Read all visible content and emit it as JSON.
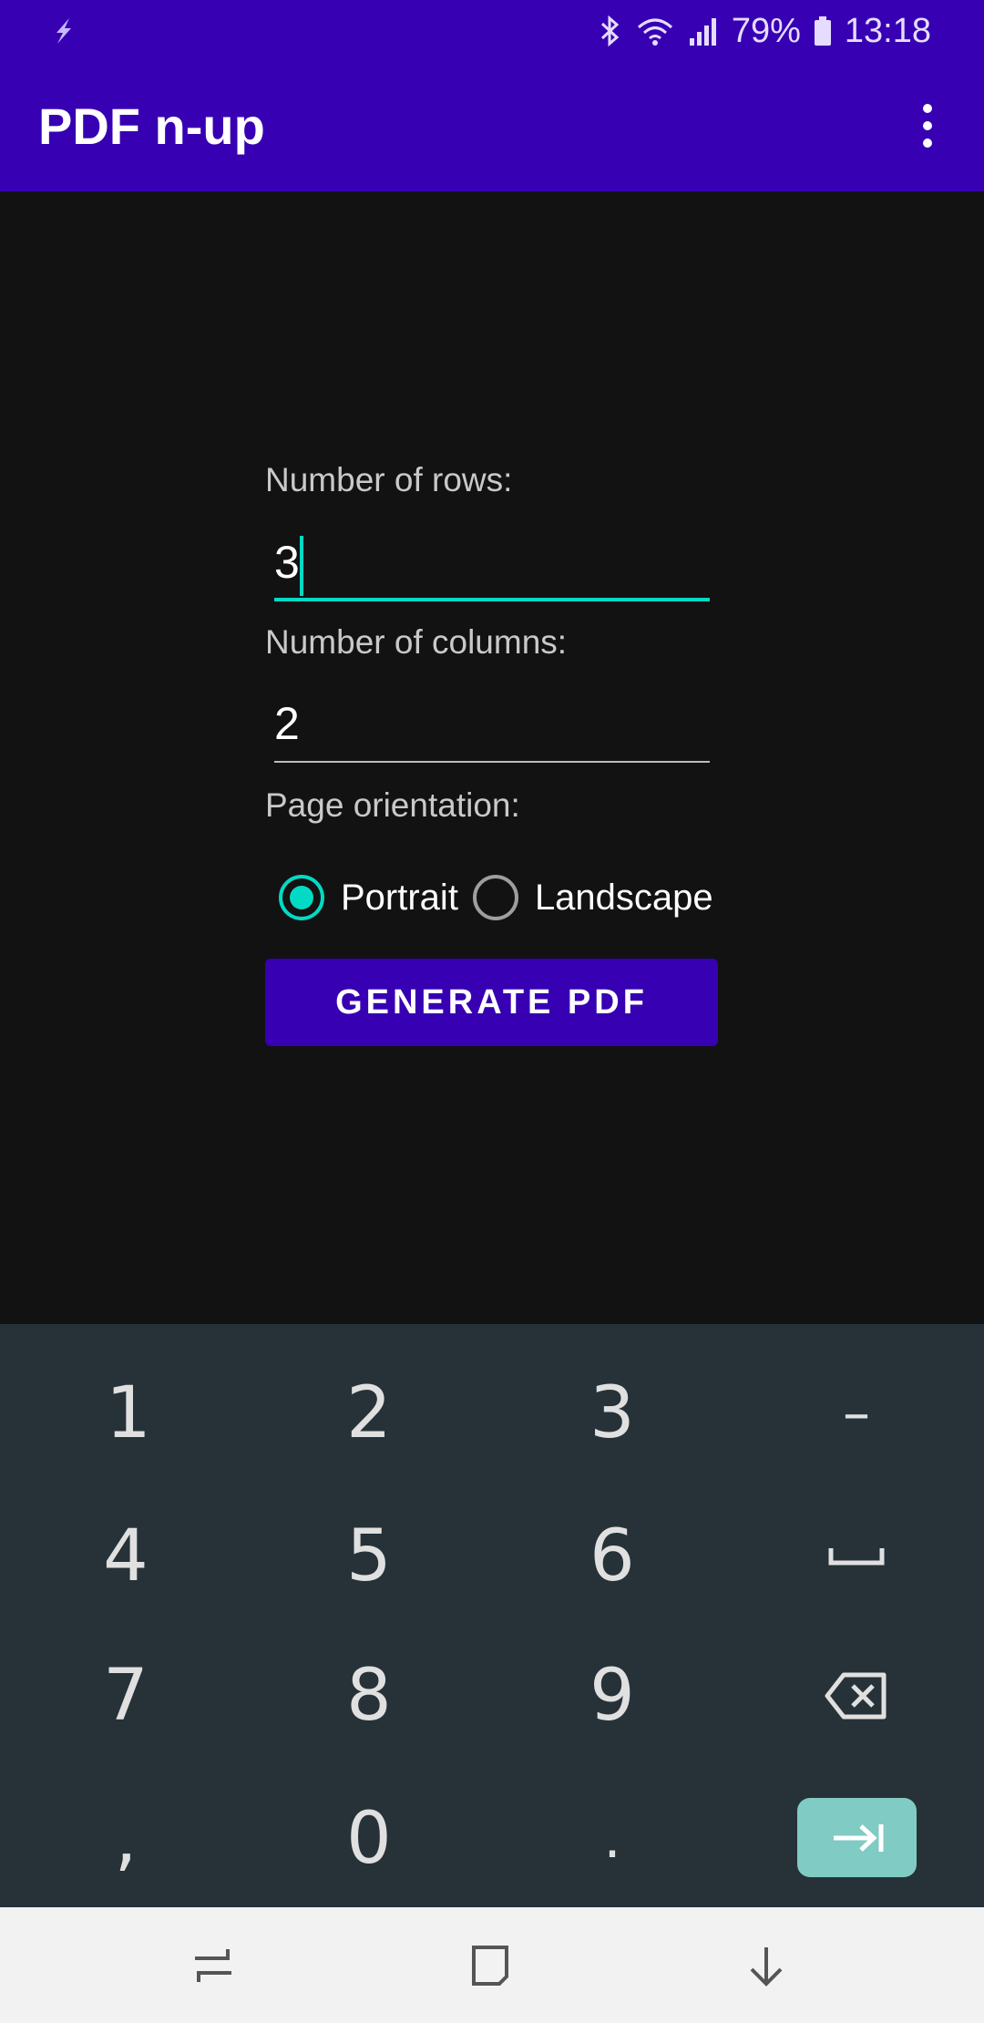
{
  "status_bar": {
    "battery": "79%",
    "time": "13:18",
    "icons": [
      "flash-icon",
      "bluetooth-icon",
      "wifi-icon",
      "signal-icon",
      "battery-icon"
    ]
  },
  "app_bar": {
    "title": "PDF n-up",
    "menu_icon": "overflow-menu-icon"
  },
  "form": {
    "rows_label": "Number of rows:",
    "rows_value": "3",
    "columns_label": "Number of columns:",
    "columns_value": "2",
    "orientation_label": "Page orientation:",
    "orientation_options": [
      {
        "label": "Portrait",
        "checked": true
      },
      {
        "label": "Landscape",
        "checked": false
      }
    ],
    "generate_label": "GENERATE PDF"
  },
  "keyboard": {
    "rows": [
      [
        "1",
        "2",
        "3",
        "–"
      ],
      [
        "4",
        "5",
        "6",
        "space-icon"
      ],
      [
        "7",
        "8",
        "9",
        "backspace-icon"
      ],
      [
        ",",
        "0",
        ".",
        "next-icon"
      ]
    ]
  },
  "nav_bar": {
    "buttons": [
      "recents-icon",
      "home-icon",
      "back-icon"
    ]
  },
  "colors": {
    "primary": "#3700b3",
    "accent": "#03dac5",
    "background": "#121212",
    "keyboard_bg": "#263238",
    "enter_key": "#80cbc4"
  }
}
